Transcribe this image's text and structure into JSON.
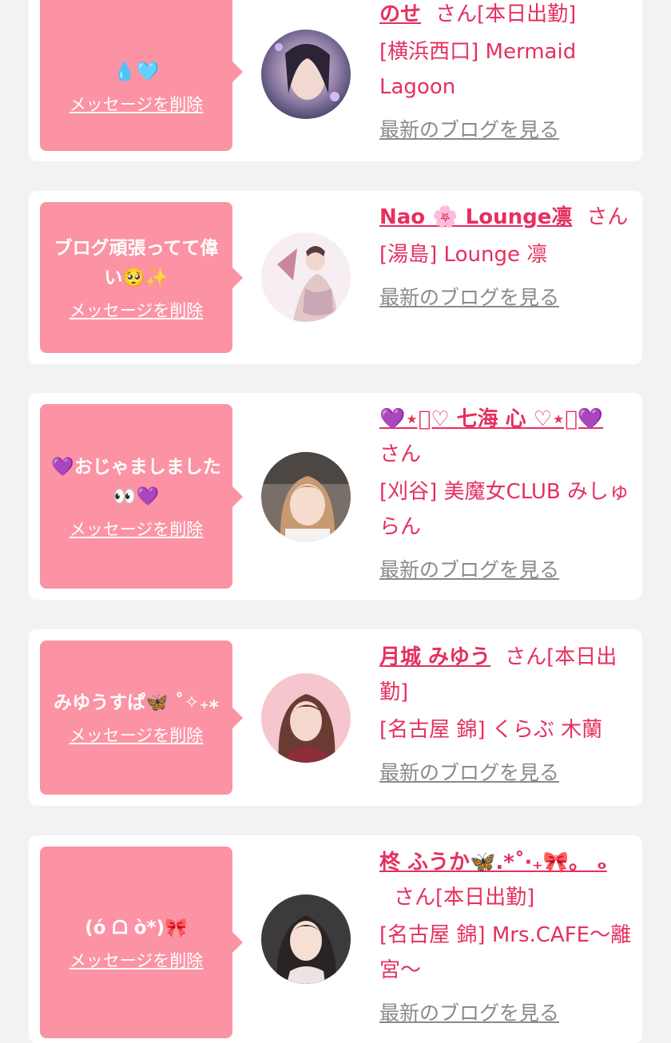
{
  "messages": [
    {
      "bubble_text": "💧🩵",
      "delete_label": "メッセージを削除",
      "name": "のせ",
      "suffix": "さん[本日出勤]",
      "shop": "[横浜西口] Mermaid Lagoon",
      "blog_link": "最新のブログを見る"
    },
    {
      "bubble_text": "ブログ頑張ってて偉い🥺✨",
      "delete_label": "メッセージを削除",
      "name": "Nao 🌸 Lounge凛",
      "suffix": "さん",
      "shop": "[湯島] Lounge 凛",
      "blog_link": "最新のブログを見る"
    },
    {
      "bubble_text": "💜おじゃましました👀💜",
      "delete_label": "メッセージを削除",
      "name": "💜⋆͛♡ 七海 心 ♡⋆͛💜",
      "suffix": "さん",
      "shop": "[刈谷] 美魔女CLUB みしゅらん",
      "blog_link": "最新のブログを見る"
    },
    {
      "bubble_text": "みゆうすぱ🦋 ˚✧₊⁎",
      "delete_label": "メッセージを削除",
      "name": "月城 みゆう",
      "suffix": "さん[本日出勤]",
      "shop": "[名古屋 錦] くらぶ 木蘭",
      "blog_link": "最新のブログを見る"
    },
    {
      "bubble_text": "(ό ᗝ ὸ*)🎀",
      "delete_label": "メッセージを削除",
      "name": "柊 ふうか🦋.*˚‧₊🎀。 ₒ",
      "suffix": "さん[本日出勤]",
      "shop": "[名古屋 錦] Mrs.CAFE〜離宮〜",
      "blog_link": "最新のブログを見る"
    }
  ],
  "colors": {
    "bubble": "#fb93a4",
    "accent": "#e5305f",
    "link_gray": "#8a8a8a",
    "background": "#f2f2f2",
    "card": "#ffffff"
  },
  "avatar_icons": [
    "avatar-1",
    "avatar-2",
    "avatar-3",
    "avatar-4",
    "avatar-5"
  ]
}
